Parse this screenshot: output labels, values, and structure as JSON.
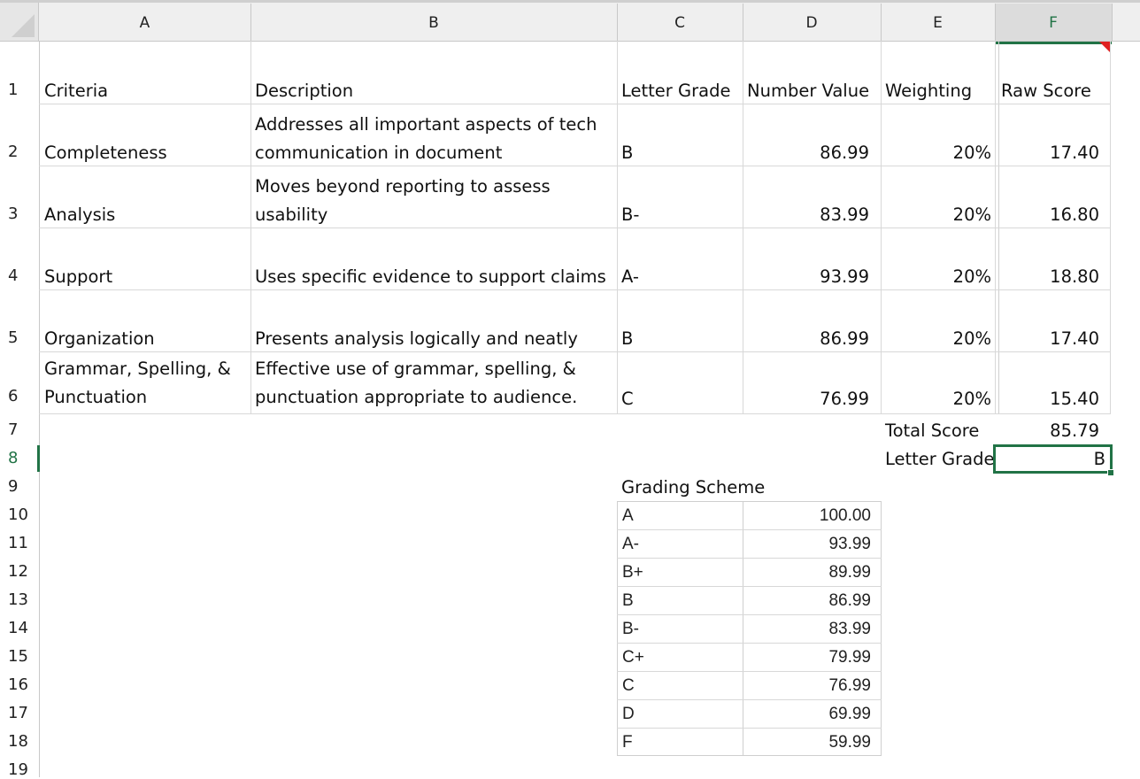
{
  "columns": [
    "A",
    "B",
    "C",
    "D",
    "E",
    "F"
  ],
  "rows": [
    "1",
    "2",
    "3",
    "4",
    "5",
    "6",
    "7",
    "8",
    "9",
    "10",
    "11",
    "12",
    "13",
    "14",
    "15",
    "16",
    "17",
    "18",
    "19"
  ],
  "header": {
    "criteria": "Criteria",
    "description": "Description",
    "letter_grade": "Letter Grade",
    "number_value": "Number Value",
    "weighting": "Weighting",
    "raw_score": "Raw Score"
  },
  "criteria": [
    {
      "name_lines": [
        "Completeness"
      ],
      "desc_lines": [
        "Addresses all important aspects of tech",
        "communication in document"
      ],
      "grade": "B",
      "value": "86.99",
      "weight": "20%",
      "raw": "17.40"
    },
    {
      "name_lines": [
        "Analysis"
      ],
      "desc_lines": [
        "Moves beyond reporting to assess",
        "usability"
      ],
      "grade": "B-",
      "value": "83.99",
      "weight": "20%",
      "raw": "16.80"
    },
    {
      "name_lines": [
        "Support"
      ],
      "desc_lines": [
        "Uses specific evidence to support claims"
      ],
      "grade": "A-",
      "value": "93.99",
      "weight": "20%",
      "raw": "18.80"
    },
    {
      "name_lines": [
        "Organization"
      ],
      "desc_lines": [
        "Presents analysis logically and neatly"
      ],
      "grade": "B",
      "value": "86.99",
      "weight": "20%",
      "raw": "17.40"
    },
    {
      "name_lines": [
        "Grammar, Spelling, &",
        "Punctuation"
      ],
      "desc_lines": [
        "Effective use of grammar, spelling, &",
        "punctuation appropriate to audience."
      ],
      "grade": "C",
      "value": "76.99",
      "weight": "20%",
      "raw": "15.40"
    }
  ],
  "total": {
    "label": "Total Score",
    "value": "85.79"
  },
  "letter": {
    "label": "Letter Grade",
    "value": "B"
  },
  "scheme": {
    "title": "Grading Scheme",
    "items": [
      {
        "grade": "A",
        "value": "100.00"
      },
      {
        "grade": "A-",
        "value": "93.99"
      },
      {
        "grade": "B+",
        "value": "89.99"
      },
      {
        "grade": "B",
        "value": "86.99"
      },
      {
        "grade": "B-",
        "value": "83.99"
      },
      {
        "grade": "C+",
        "value": "79.99"
      },
      {
        "grade": "C",
        "value": "76.99"
      },
      {
        "grade": "D",
        "value": "69.99"
      },
      {
        "grade": "F",
        "value": "59.99"
      }
    ]
  },
  "selection": {
    "column": "F",
    "row": "8"
  },
  "colors": {
    "selection": "#217346",
    "comment_marker": "#e02020"
  }
}
